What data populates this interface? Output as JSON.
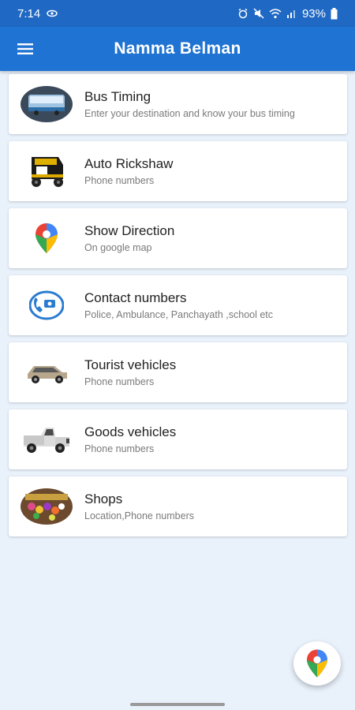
{
  "status_bar": {
    "time": "7:14",
    "battery": "93%"
  },
  "app_bar": {
    "title": "Namma Belman"
  },
  "items": [
    {
      "title": "Bus Timing",
      "subtitle": "Enter your destination and know your bus timing",
      "icon": "bus-icon"
    },
    {
      "title": "Auto Rickshaw",
      "subtitle": "Phone numbers",
      "icon": "auto-rickshaw-icon"
    },
    {
      "title": "Show Direction",
      "subtitle": "On google map",
      "icon": "map-pin-icon"
    },
    {
      "title": "Contact numbers",
      "subtitle": "Police, Ambulance, Panchayath ,school etc",
      "icon": "phone-contact-icon"
    },
    {
      "title": "Tourist vehicles",
      "subtitle": "Phone numbers",
      "icon": "car-icon"
    },
    {
      "title": "Goods vehicles",
      "subtitle": "Phone numbers",
      "icon": "pickup-truck-icon"
    },
    {
      "title": "Shops",
      "subtitle": "Location,Phone numbers",
      "icon": "shop-icon"
    }
  ],
  "colors": {
    "status_bar": "#1f68c4",
    "app_bar": "#1f73d2",
    "background": "#e9f1fb"
  }
}
